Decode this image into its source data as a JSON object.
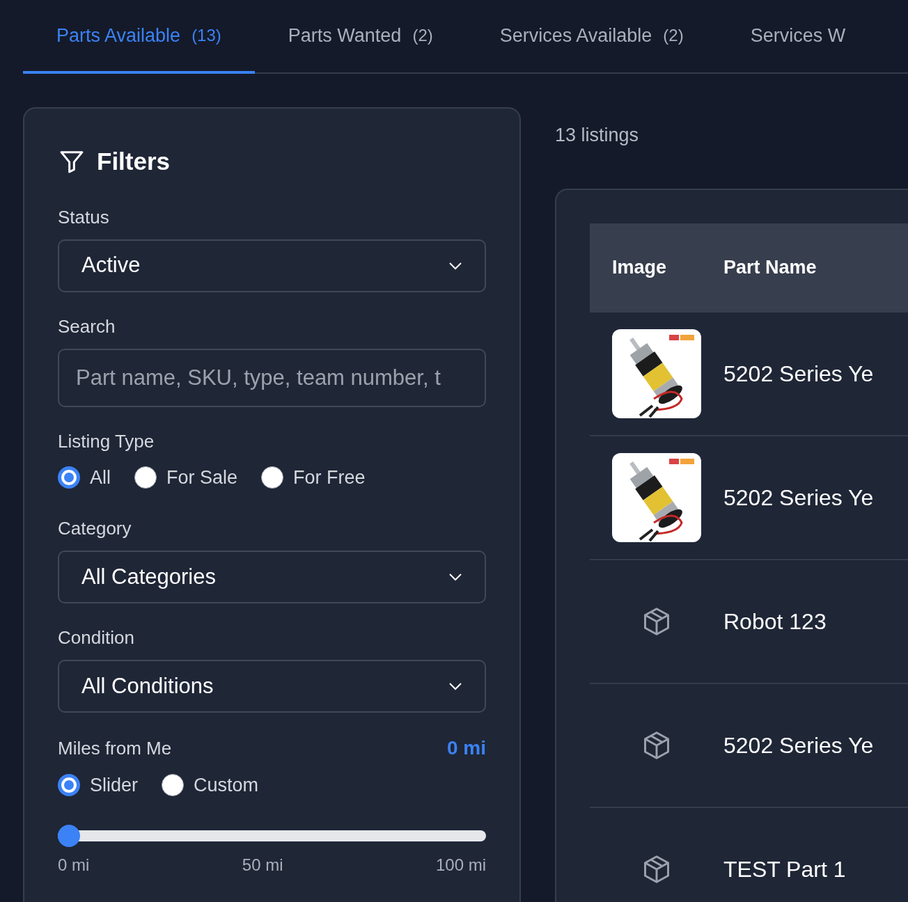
{
  "tabs": [
    {
      "label": "Parts Available",
      "count": "(13)",
      "selected": true
    },
    {
      "label": "Parts Wanted",
      "count": "(2)",
      "selected": false
    },
    {
      "label": "Services Available",
      "count": "(2)",
      "selected": false
    },
    {
      "label": "Services W",
      "selected": false
    }
  ],
  "filters": {
    "title": "Filters",
    "status": {
      "label": "Status",
      "value": "Active"
    },
    "search": {
      "label": "Search",
      "placeholder": "Part name, SKU, type, team number, t"
    },
    "listing_type": {
      "label": "Listing Type",
      "options": [
        {
          "label": "All",
          "selected": true
        },
        {
          "label": "For Sale",
          "selected": false
        },
        {
          "label": "For Free",
          "selected": false
        }
      ]
    },
    "category": {
      "label": "Category",
      "value": "All Categories"
    },
    "condition": {
      "label": "Condition",
      "value": "All Conditions"
    },
    "miles": {
      "label": "Miles from Me",
      "value": "0 mi",
      "modes": [
        {
          "label": "Slider",
          "selected": true
        },
        {
          "label": "Custom",
          "selected": false
        }
      ],
      "level": 0,
      "ticks": [
        "0 mi",
        "50 mi",
        "100 mi"
      ]
    }
  },
  "listings": {
    "count_text": "13 listings",
    "columns": [
      "Image",
      "Part Name"
    ],
    "rows": [
      {
        "name": "5202 Series Ye"
      },
      {
        "name": "5202 Series Ye"
      },
      {
        "kind": "placeholder",
        "name": "Robot 123"
      },
      {
        "kind": "placeholder",
        "name": "5202 Series Ye"
      },
      {
        "kind": "placeholder",
        "name": "TEST Part 1"
      }
    ]
  }
}
